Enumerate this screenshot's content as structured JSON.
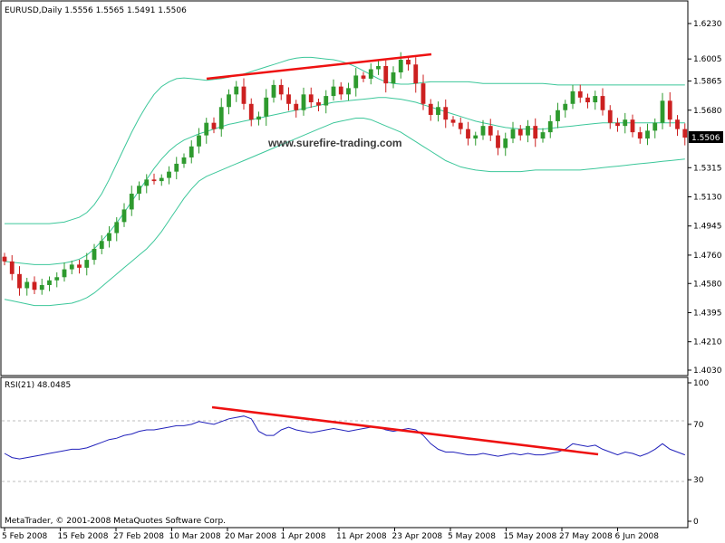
{
  "header": {
    "symbol_line": "EURUSD,Daily  1.5556 1.5565 1.5491 1.5506"
  },
  "watermark": "www.surefire-trading.com",
  "footer": {
    "copyright": "MetaTrader, © 2001-2008 MetaQuotes Software Corp."
  },
  "rsi_panel": {
    "label": "RSI(21) 48.0485"
  },
  "colors": {
    "bull": "#2e9a2e",
    "bear": "#cc2020",
    "bands": "#3cc79a",
    "rsi_line": "#2222bb",
    "trendline": "#ee1111",
    "price_badge_bg": "#000000",
    "price_badge_text": "#ffffff"
  },
  "chart_data": [
    {
      "type": "candlestick",
      "title": "EURUSD,Daily  1.5556 1.5565 1.5491 1.5506",
      "y_axis_ticks": [
        "1.6230",
        "1.6005",
        "1.5865",
        "1.5680",
        "1.5506",
        "1.5315",
        "1.5130",
        "1.4945",
        "1.4760",
        "1.4580",
        "1.4395",
        "1.4210",
        "1.4030"
      ],
      "ylim": [
        1.403,
        1.623
      ],
      "current_price": "1.5506",
      "x_tick_labels": [
        "5 Feb 2008",
        "15 Feb 2008",
        "27 Feb 2008",
        "10 Mar 2008",
        "20 Mar 2008",
        "1 Apr 2008",
        "11 Apr 2008",
        "23 Apr 2008",
        "5 May 2008",
        "15 May 2008",
        "27 May 2008",
        "6 Jun 2008"
      ],
      "close": [
        1.472,
        1.464,
        1.455,
        1.459,
        1.454,
        1.457,
        1.46,
        1.462,
        1.467,
        1.47,
        1.468,
        1.473,
        1.48,
        1.485,
        1.49,
        1.497,
        1.505,
        1.515,
        1.52,
        1.524,
        1.523,
        1.525,
        1.529,
        1.534,
        1.538,
        1.545,
        1.552,
        1.56,
        1.556,
        1.57,
        1.578,
        1.583,
        1.572,
        1.562,
        1.564,
        1.576,
        1.584,
        1.578,
        1.572,
        1.568,
        1.578,
        1.573,
        1.571,
        1.577,
        1.583,
        1.578,
        1.582,
        1.59,
        1.588,
        1.594,
        1.596,
        1.585,
        1.592,
        1.6,
        1.597,
        1.585,
        1.572,
        1.565,
        1.57,
        1.562,
        1.56,
        1.556,
        1.55,
        1.552,
        1.558,
        1.552,
        1.544,
        1.55,
        1.556,
        1.552,
        1.558,
        1.55,
        1.554,
        1.561,
        1.568,
        1.572,
        1.58,
        1.576,
        1.573,
        1.577,
        1.568,
        1.56,
        1.558,
        1.562,
        1.554,
        1.55,
        1.555,
        1.56,
        1.574,
        1.562,
        1.556,
        1.5506
      ],
      "bands": {
        "upper": [
          1.496,
          1.496,
          1.496,
          1.496,
          1.496,
          1.496,
          1.496,
          1.4965,
          1.497,
          1.4985,
          1.5,
          1.503,
          1.508,
          1.515,
          1.524,
          1.534,
          1.544,
          1.554,
          1.563,
          1.571,
          1.578,
          1.583,
          1.586,
          1.588,
          1.5885,
          1.588,
          1.5875,
          1.587,
          1.5875,
          1.588,
          1.589,
          1.59,
          1.591,
          1.5925,
          1.594,
          1.5955,
          1.597,
          1.5985,
          1.6,
          1.601,
          1.6015,
          1.6015,
          1.601,
          1.6005,
          1.6,
          1.599,
          1.5975,
          1.5955,
          1.593,
          1.5905,
          1.588,
          1.586,
          1.585,
          1.5845,
          1.5845,
          1.585,
          1.5855,
          1.586,
          1.586,
          1.586,
          1.586,
          1.586,
          1.586,
          1.5855,
          1.585,
          1.585,
          1.585,
          1.585,
          1.585,
          1.585,
          1.585,
          1.585,
          1.585,
          1.5845,
          1.584,
          1.584,
          1.584,
          1.584,
          1.584,
          1.584,
          1.584,
          1.584,
          1.584,
          1.584,
          1.584,
          1.584,
          1.584,
          1.584,
          1.584,
          1.584,
          1.584,
          1.584
        ],
        "middle": [
          1.472,
          1.4715,
          1.471,
          1.4705,
          1.47,
          1.47,
          1.47,
          1.4705,
          1.471,
          1.472,
          1.4735,
          1.476,
          1.48,
          1.485,
          1.4905,
          1.4965,
          1.503,
          1.51,
          1.517,
          1.524,
          1.531,
          1.537,
          1.542,
          1.546,
          1.549,
          1.551,
          1.553,
          1.5545,
          1.556,
          1.5575,
          1.559,
          1.56,
          1.561,
          1.562,
          1.563,
          1.564,
          1.565,
          1.566,
          1.567,
          1.568,
          1.569,
          1.57,
          1.571,
          1.572,
          1.573,
          1.5735,
          1.574,
          1.5745,
          1.575,
          1.5755,
          1.576,
          1.576,
          1.5755,
          1.575,
          1.574,
          1.573,
          1.5715,
          1.57,
          1.5685,
          1.567,
          1.5655,
          1.564,
          1.5625,
          1.561,
          1.56,
          1.559,
          1.558,
          1.557,
          1.5565,
          1.556,
          1.556,
          1.556,
          1.556,
          1.5565,
          1.557,
          1.5575,
          1.558,
          1.5585,
          1.559,
          1.5595,
          1.56,
          1.56,
          1.56,
          1.56,
          1.56,
          1.56,
          1.56,
          1.56,
          1.56,
          1.56,
          1.56,
          1.56
        ],
        "lower": [
          1.448,
          1.447,
          1.446,
          1.445,
          1.444,
          1.444,
          1.444,
          1.4445,
          1.445,
          1.4455,
          1.447,
          1.449,
          1.452,
          1.456,
          1.46,
          1.464,
          1.468,
          1.472,
          1.476,
          1.48,
          1.485,
          1.491,
          1.498,
          1.505,
          1.512,
          1.518,
          1.523,
          1.526,
          1.528,
          1.53,
          1.532,
          1.534,
          1.536,
          1.538,
          1.54,
          1.542,
          1.544,
          1.546,
          1.548,
          1.55,
          1.552,
          1.554,
          1.556,
          1.558,
          1.56,
          1.561,
          1.562,
          1.563,
          1.563,
          1.562,
          1.56,
          1.558,
          1.556,
          1.554,
          1.551,
          1.548,
          1.545,
          1.542,
          1.539,
          1.536,
          1.534,
          1.532,
          1.531,
          1.53,
          1.5295,
          1.529,
          1.529,
          1.529,
          1.529,
          1.529,
          1.5295,
          1.53,
          1.53,
          1.53,
          1.53,
          1.53,
          1.53,
          1.53,
          1.5305,
          1.531,
          1.5315,
          1.532,
          1.5325,
          1.533,
          1.5335,
          1.534,
          1.5345,
          1.535,
          1.5355,
          1.536,
          1.5365,
          1.537
        ]
      }
    },
    {
      "type": "line",
      "title": "RSI(21) 48.0485",
      "y_axis_ticks": [
        "100",
        "70",
        "30",
        "0"
      ],
      "ylim": [
        0,
        100
      ],
      "levels": [
        70,
        30
      ],
      "series": [
        {
          "name": "RSI(21)",
          "values": [
            49,
            46,
            45,
            46,
            47,
            48,
            49,
            50,
            51,
            52,
            52,
            53,
            55,
            57,
            59,
            60,
            62,
            63,
            65,
            66,
            66,
            67,
            68,
            69,
            69,
            70,
            72,
            71,
            70,
            72,
            74,
            75,
            76,
            74,
            65,
            62,
            62,
            66,
            68,
            66,
            65,
            64,
            65,
            66,
            67,
            66,
            65,
            66,
            67,
            68,
            68,
            66,
            65,
            66,
            67,
            66,
            62,
            56,
            52,
            50,
            50,
            49,
            48,
            48,
            49,
            48,
            47,
            48,
            49,
            48,
            49,
            48,
            48,
            49,
            50,
            52,
            56,
            55,
            54,
            55,
            52,
            50,
            48,
            50,
            49,
            47,
            49,
            52,
            56,
            52,
            50,
            48
          ]
        }
      ]
    }
  ]
}
